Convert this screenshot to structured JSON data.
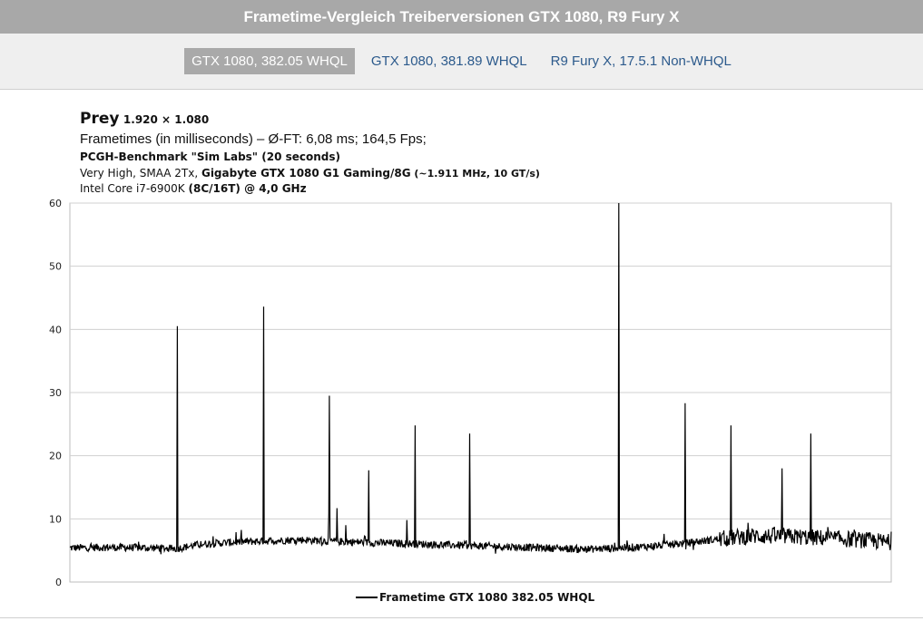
{
  "page_title": "Frametime-Vergleich Treiberversionen GTX 1080, R9 Fury X",
  "tabs": [
    {
      "label": "GTX 1080, 382.05 WHQL",
      "active": true
    },
    {
      "label": "GTX 1080, 381.89 WHQL",
      "active": false
    },
    {
      "label": "R9 Fury X, 17.5.1 Non-WHQL",
      "active": false
    }
  ],
  "header": {
    "game": "Prey",
    "resolution": "1.920 × 1.080",
    "line2": "Frametimes (in milliseconds) – Ø-FT: 6,08 ms; 164,5 Fps;",
    "line3": "PCGH-Benchmark \"Sim Labs\" (20 seconds)",
    "line4_prefix": "Very High, SMAA 2Tx,",
    "line4_bold": "Gigabyte GTX 1080 G1 Gaming/8G",
    "line4_suffix": "(~1.911 MHz, 10 GT/s)",
    "line5_prefix": "Intel Core i7-6900K",
    "line5_bold": "(8C/16T) @ 4,0 GHz"
  },
  "colors": {
    "titlebar_bg": "#a8a8a8",
    "tab_active_bg": "#a9a9a9",
    "tab_link": "#2c5a8c",
    "line": "#000000",
    "grid": "#d0d0d0"
  },
  "chart_data": {
    "type": "line",
    "title": "Prey 1.920 × 1.080",
    "ylabel": "",
    "xlabel": "",
    "ylim": [
      0,
      60
    ],
    "yticks": [
      0,
      10,
      20,
      30,
      40,
      50,
      60
    ],
    "grid": true,
    "legend_position": "bottom",
    "series": [
      {
        "name": "Frametime GTX 1080 382.05 WHQL",
        "baseline": [
          [
            0,
            5.4
          ],
          [
            0.05,
            5.5
          ],
          [
            0.1,
            5.4
          ],
          [
            0.13,
            5.3
          ],
          [
            0.16,
            6.0
          ],
          [
            0.2,
            6.3
          ],
          [
            0.24,
            6.5
          ],
          [
            0.28,
            6.7
          ],
          [
            0.33,
            6.4
          ],
          [
            0.38,
            6.2
          ],
          [
            0.43,
            6.0
          ],
          [
            0.48,
            5.8
          ],
          [
            0.53,
            5.6
          ],
          [
            0.58,
            5.4
          ],
          [
            0.63,
            5.2
          ],
          [
            0.67,
            5.4
          ],
          [
            0.7,
            5.6
          ],
          [
            0.74,
            6.0
          ],
          [
            0.79,
            6.8
          ],
          [
            0.83,
            7.3
          ],
          [
            0.88,
            7.2
          ],
          [
            0.93,
            6.9
          ],
          [
            0.97,
            6.6
          ],
          [
            1.0,
            6.3
          ]
        ],
        "spikes": [
          [
            0.131,
            40.5
          ],
          [
            0.236,
            43.6
          ],
          [
            0.316,
            29.5
          ],
          [
            0.325,
            11.7
          ],
          [
            0.364,
            17.7
          ],
          [
            0.42,
            24.8
          ],
          [
            0.487,
            23.5
          ],
          [
            0.668,
            60.0
          ],
          [
            0.749,
            28.3
          ],
          [
            0.805,
            24.8
          ],
          [
            0.867,
            18.0
          ],
          [
            0.902,
            23.5
          ],
          [
            0.315,
            10.8
          ],
          [
            0.202,
            7.9
          ],
          [
            0.41,
            9.8
          ],
          [
            0.336,
            9.0
          ]
        ],
        "noise_ms": 0.6
      }
    ]
  }
}
